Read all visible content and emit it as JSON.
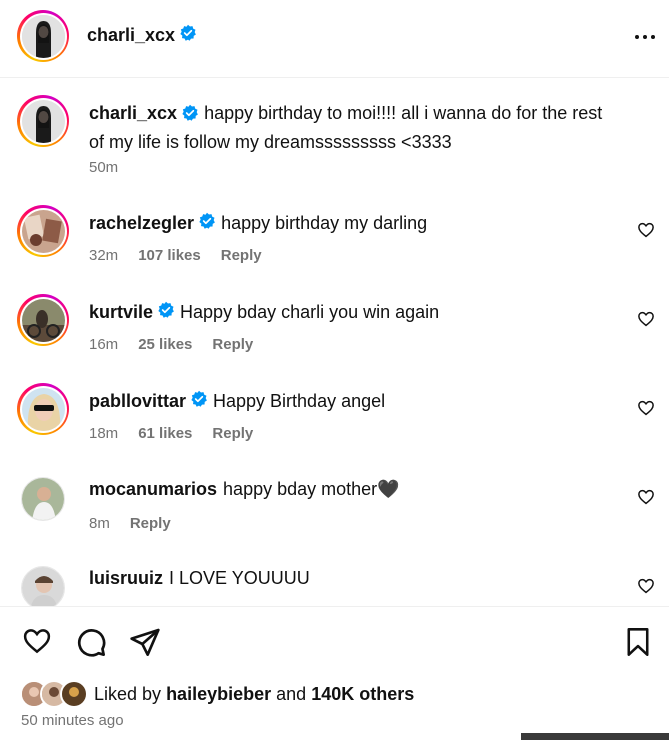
{
  "header": {
    "username": "charli_xcx",
    "more_icon": "more-horizontal-icon"
  },
  "caption": {
    "username": "charli_xcx",
    "text_line1": "happy birthday to moi!!!! all i wanna do for the rest",
    "text_line2": "of my life is follow my dreamsssssssss <3333",
    "time": "50m"
  },
  "comments": [
    {
      "username": "rachelzegler",
      "verified": true,
      "text": "happy birthday my darling",
      "time": "32m",
      "likes": "107 likes",
      "reply": "Reply"
    },
    {
      "username": "kurtvile",
      "verified": true,
      "text": "Happy bday charli you win again",
      "time": "16m",
      "likes": "25 likes",
      "reply": "Reply"
    },
    {
      "username": "pabllovittar",
      "verified": true,
      "text": "Happy Birthday angel",
      "time": "18m",
      "likes": "61 likes",
      "reply": "Reply"
    },
    {
      "username": "mocanumarios",
      "verified": false,
      "text": "happy bday mother🖤",
      "time": "8m",
      "likes": "",
      "reply": "Reply"
    },
    {
      "username": "luisruuiz",
      "verified": false,
      "text": "I LOVE YOUUUU",
      "time": "",
      "likes": "",
      "reply": ""
    }
  ],
  "actions": {
    "like_icon": "heart-icon",
    "comment_icon": "comment-icon",
    "share_icon": "send-icon",
    "save_icon": "bookmark-icon"
  },
  "likes": {
    "prefix": "Liked by",
    "user": "haileybieber",
    "and": "and",
    "others": "140K others"
  },
  "timestamp": "50 minutes ago",
  "colors": {
    "verified": "#0095f6",
    "text": "#262626",
    "muted": "#737373"
  }
}
